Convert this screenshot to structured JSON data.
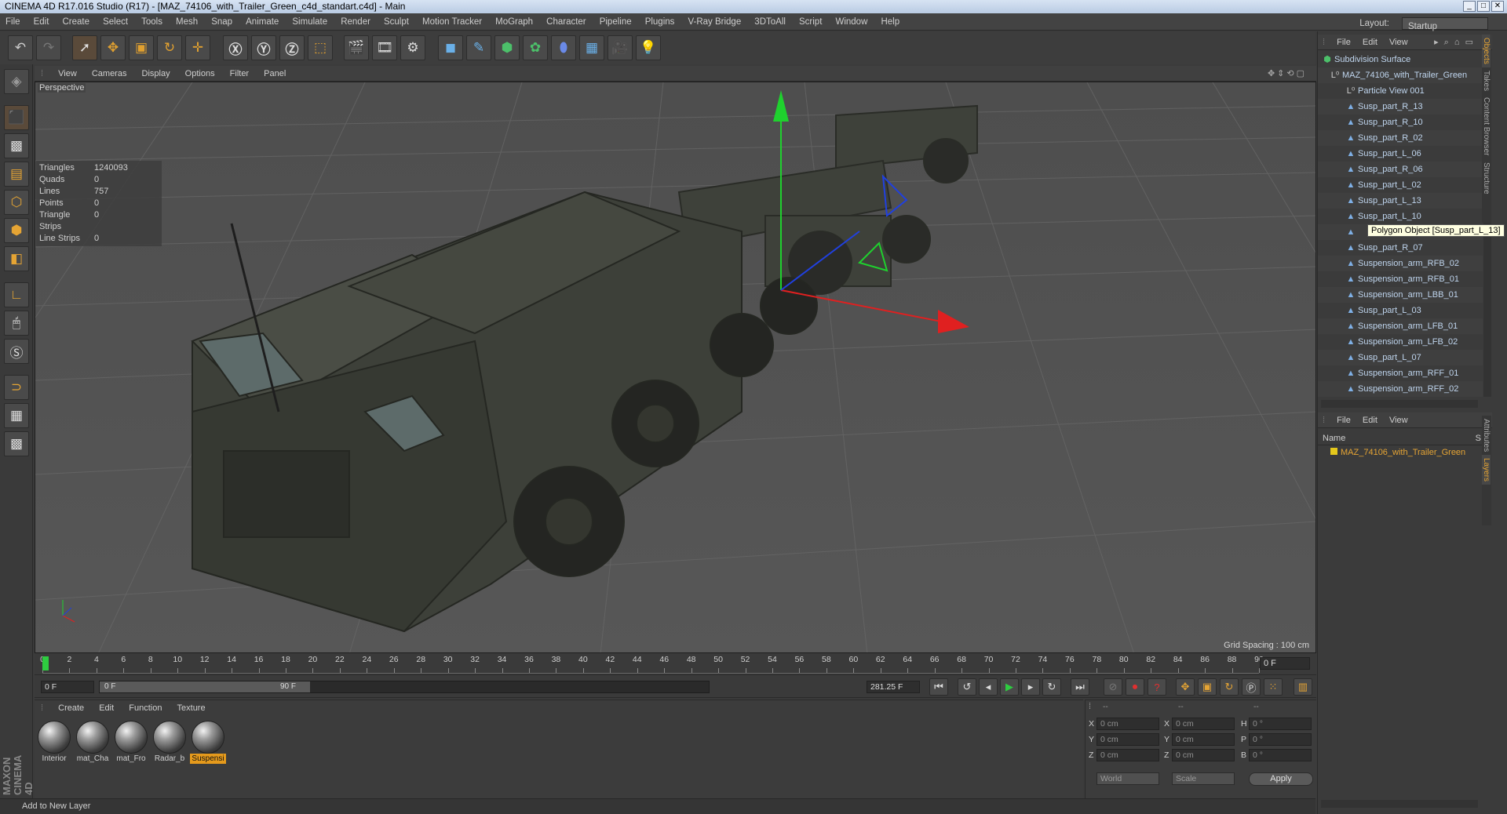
{
  "window": {
    "title": "CINEMA 4D R17.016 Studio (R17) - [MAZ_74106_with_Trailer_Green_c4d_standart.c4d] - Main",
    "buttons": [
      "_",
      "□",
      "✕"
    ]
  },
  "menu": [
    "File",
    "Edit",
    "Create",
    "Select",
    "Tools",
    "Mesh",
    "Snap",
    "Animate",
    "Simulate",
    "Render",
    "Sculpt",
    "Motion Tracker",
    "MoGraph",
    "Character",
    "Pipeline",
    "Plugins",
    "V-Ray Bridge",
    "3DToAll",
    "Script",
    "Window",
    "Help"
  ],
  "layout": {
    "label": "Layout:",
    "value": "Startup"
  },
  "viewport": {
    "menu": [
      "View",
      "Cameras",
      "Display",
      "Options",
      "Filter",
      "Panel"
    ],
    "label": "Perspective",
    "stats": [
      {
        "k": "Triangles",
        "v": "1240093"
      },
      {
        "k": "Quads",
        "v": "0"
      },
      {
        "k": "Lines",
        "v": "757"
      },
      {
        "k": "Points",
        "v": "0"
      },
      {
        "k": "Triangle Strips",
        "v": "0"
      },
      {
        "k": "Line Strips",
        "v": "0"
      }
    ],
    "grid_spacing": "Grid Spacing : 100 cm"
  },
  "timeline": {
    "ticks": [
      "0",
      "2",
      "4",
      "6",
      "8",
      "10",
      "12",
      "14",
      "16",
      "18",
      "20",
      "22",
      "24",
      "26",
      "28",
      "30",
      "32",
      "34",
      "36",
      "38",
      "40",
      "42",
      "44",
      "46",
      "48",
      "50",
      "52",
      "54",
      "56",
      "58",
      "60",
      "62",
      "64",
      "66",
      "68",
      "70",
      "72",
      "74",
      "76",
      "78",
      "80",
      "82",
      "84",
      "86",
      "88",
      "90"
    ],
    "current": "0 F"
  },
  "transport": {
    "start": "0 F",
    "range_start": "0 F",
    "range_end": "90 F",
    "range_fill": 1.0,
    "fps": "281.25 F"
  },
  "materials": {
    "menu": [
      "Create",
      "Edit",
      "Function",
      "Texture"
    ],
    "items": [
      {
        "name": "Interior",
        "selected": false
      },
      {
        "name": "mat_Cha",
        "selected": false
      },
      {
        "name": "mat_Fro",
        "selected": false
      },
      {
        "name": "Radar_b",
        "selected": false
      },
      {
        "name": "Suspensi",
        "selected": true
      }
    ]
  },
  "coords": {
    "header": [
      "--",
      "--",
      "--"
    ],
    "rows": [
      {
        "a": "X",
        "av": "0 cm",
        "b": "X",
        "bv": "0 cm",
        "c": "H",
        "cv": "0 °"
      },
      {
        "a": "Y",
        "av": "0 cm",
        "b": "Y",
        "bv": "0 cm",
        "c": "P",
        "cv": "0 °"
      },
      {
        "a": "Z",
        "av": "0 cm",
        "b": "Z",
        "bv": "0 cm",
        "c": "B",
        "cv": "0 °"
      }
    ],
    "world": "World",
    "scale": "Scale",
    "apply": "Apply"
  },
  "status": "Add to New Layer",
  "objects": {
    "menu": [
      "File",
      "Edit",
      "View"
    ],
    "items": [
      "Subdivision Surface",
      "MAZ_74106_with_Trailer_Green",
      "Particle View 001",
      "Susp_part_R_13",
      "Susp_part_R_10",
      "Susp_part_R_02",
      "Susp_part_L_06",
      "Susp_part_R_06",
      "Susp_part_L_02",
      "Susp_part_L_13",
      "Susp_part_L_10",
      "",
      "Susp_part_R_07",
      "Suspension_arm_RFB_02",
      "Suspension_arm_RFB_01",
      "Suspension_arm_LBB_01",
      "Susp_part_L_03",
      "Suspension_arm_LFB_01",
      "Suspension_arm_LFB_02",
      "Susp_part_L_07",
      "Suspension_arm_RFF_01",
      "Suspension_arm_RFF_02"
    ],
    "tooltip": "Polygon Object [Susp_part_L_13]"
  },
  "layers": {
    "menu": [
      "File",
      "Edit",
      "View"
    ],
    "column": "Name",
    "column_s": "S",
    "item": "MAZ_74106_with_Trailer_Green",
    "item_color": "#e5c81c"
  },
  "side_tabs_top": [
    "Objects",
    "Takes",
    "Content Browser",
    "Structure"
  ],
  "side_tabs_bottom": [
    "Attributes",
    "Layers"
  ]
}
